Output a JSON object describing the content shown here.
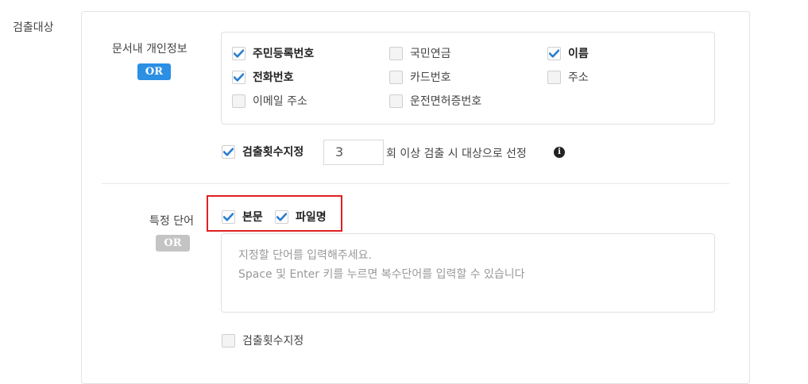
{
  "section": {
    "title": "검출대상"
  },
  "personal_info": {
    "label": "문서내 개인정보",
    "badge": "OR",
    "items": [
      {
        "label": "주민등록번호",
        "checked": true
      },
      {
        "label": "국민연금",
        "checked": false
      },
      {
        "label": "이름",
        "checked": true
      },
      {
        "label": "전화번호",
        "checked": true
      },
      {
        "label": "카드번호",
        "checked": false
      },
      {
        "label": "주소",
        "checked": false
      },
      {
        "label": "이메일 주소",
        "checked": false
      },
      {
        "label": "운전면허증번호",
        "checked": false
      }
    ],
    "count_option": {
      "label": "검출횟수지정",
      "checked": true,
      "value": "3",
      "suffix": "회 이상 검출 시 대상으로 선정"
    }
  },
  "keyword": {
    "label": "특정 단어",
    "badge": "OR",
    "targets": [
      {
        "label": "본문",
        "checked": true
      },
      {
        "label": "파일명",
        "checked": true
      }
    ],
    "textarea_line1": "지정할 단어를 입력해주세요.",
    "textarea_line2": "Space 및 Enter 키를 누르면 복수단어를 입력할 수 있습니다",
    "count_option": {
      "label": "검출횟수지정",
      "checked": false
    }
  }
}
